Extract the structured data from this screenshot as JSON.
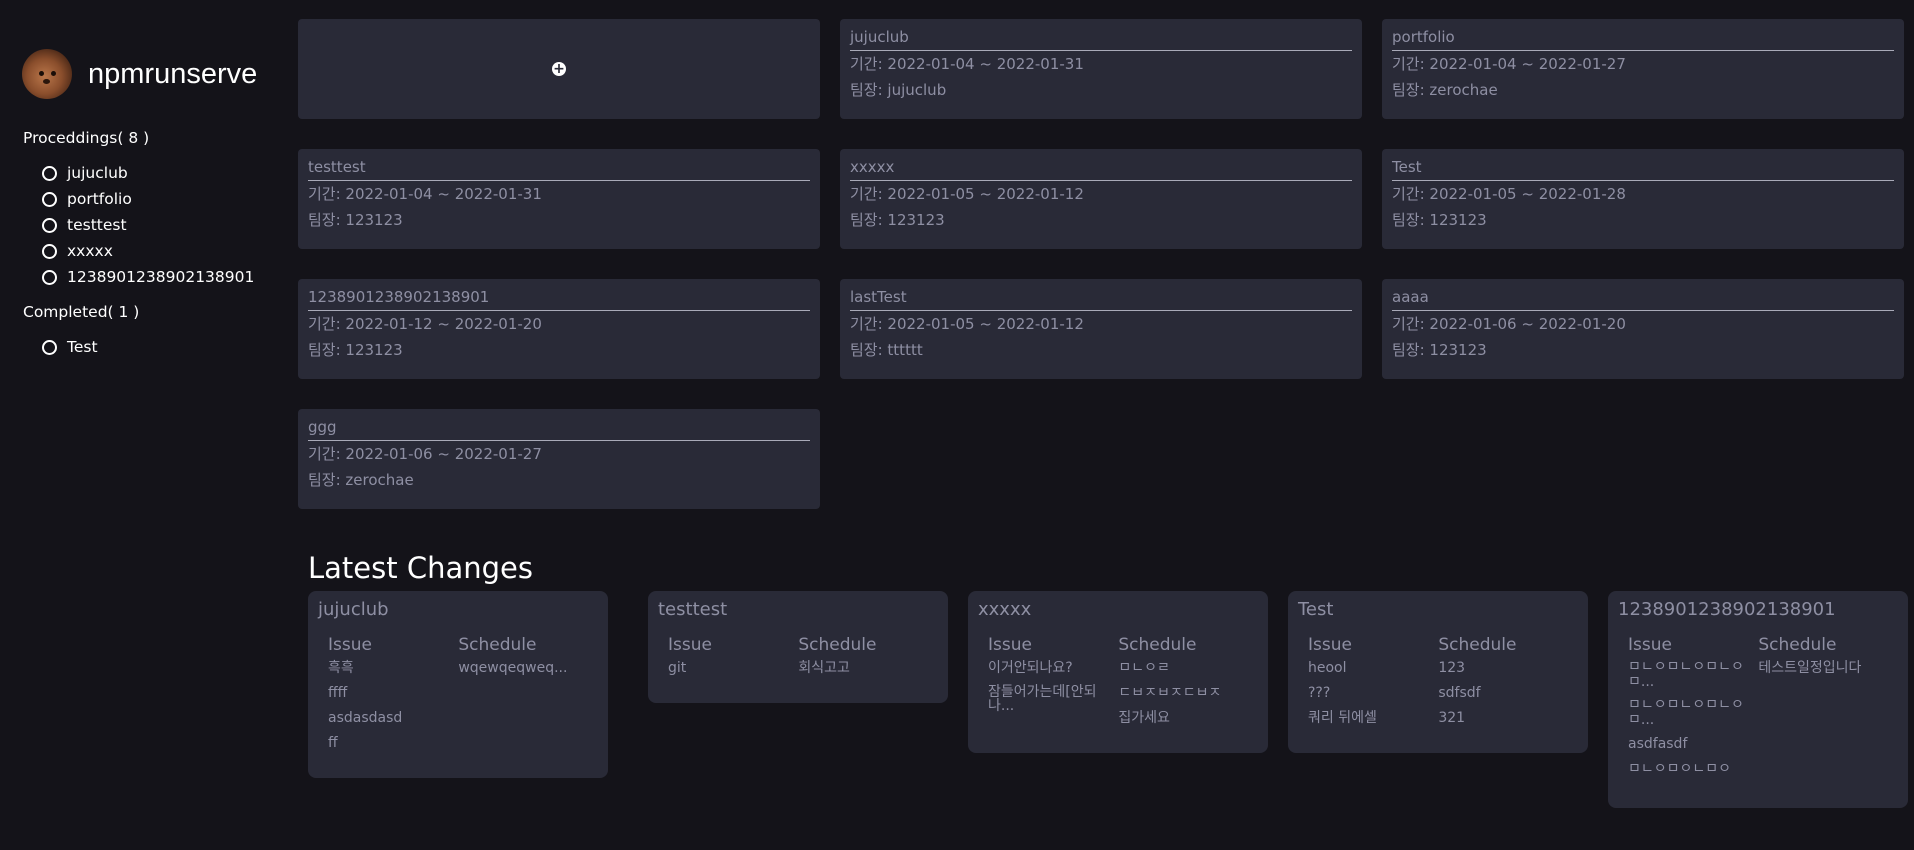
{
  "sidebar": {
    "username": "npmrunserve",
    "proceedings_title": "Proceddings( 8 )",
    "proceedings": [
      "jujuclub",
      "portfolio",
      "testtest",
      "xxxxx",
      "1238901238902138901"
    ],
    "completed_title": "Completed( 1 )",
    "completed": [
      "Test"
    ]
  },
  "add_card": {
    "icon": "plus-circle-icon"
  },
  "cards": [
    {
      "title": "jujuclub",
      "period": "기간: 2022-01-04 ~ 2022-01-31",
      "leader": "팀장: jujuclub"
    },
    {
      "title": "portfolio",
      "period": "기간: 2022-01-04 ~ 2022-01-27",
      "leader": "팀장: zerochae"
    },
    {
      "title": "testtest",
      "period": "기간: 2022-01-04 ~ 2022-01-31",
      "leader": "팀장: 123123"
    },
    {
      "title": "xxxxx",
      "period": "기간: 2022-01-05 ~ 2022-01-12",
      "leader": "팀장: 123123"
    },
    {
      "title": "Test",
      "period": "기간: 2022-01-05 ~ 2022-01-28",
      "leader": "팀장: 123123"
    },
    {
      "title": "1238901238902138901",
      "period": "기간: 2022-01-12 ~ 2022-01-20",
      "leader": "팀장: 123123"
    },
    {
      "title": "lastTest",
      "period": "기간: 2022-01-05 ~ 2022-01-12",
      "leader": "팀장: tttttt"
    },
    {
      "title": "aaaa",
      "period": "기간: 2022-01-06 ~ 2022-01-20",
      "leader": "팀장: 123123"
    },
    {
      "title": "ggg",
      "period": "기간: 2022-01-06 ~ 2022-01-27",
      "leader": "팀장: zerochae"
    }
  ],
  "latest": {
    "title": "Latest Changes",
    "issue_label": "Issue",
    "schedule_label": "Schedule",
    "items": [
      {
        "name": "jujuclub",
        "issues": [
          "흑흑",
          "ffff",
          "asdasdasd",
          "ff"
        ],
        "schedules": [
          "wqewqeqweq..."
        ]
      },
      {
        "name": "testtest",
        "issues": [
          "git"
        ],
        "schedules": [
          "회식고고"
        ]
      },
      {
        "name": "xxxxx",
        "issues": [
          "이거안되나요?",
          "잠들어가는데[안되나..."
        ],
        "schedules": [
          "ㅁㄴㅇㄹ",
          "ㄷㅂㅈㅂㅈㄷㅂㅈ",
          "집가세요"
        ]
      },
      {
        "name": "Test",
        "issues": [
          "heool",
          "???",
          "쿼리 뒤에셀"
        ],
        "schedules": [
          "123",
          "sdfsdf",
          "321"
        ]
      },
      {
        "name": "1238901238902138901",
        "issues": [
          "ㅁㄴㅇㅁㄴㅇㅁㄴㅇㅁ...",
          "ㅁㄴㅇㅁㄴㅇㅁㄴㅇㅁ...",
          "asdfasdf",
          "ㅁㄴㅇㅁㅇㄴㅁㅇ"
        ],
        "schedules": [
          "테스트일정입니다"
        ]
      }
    ]
  }
}
